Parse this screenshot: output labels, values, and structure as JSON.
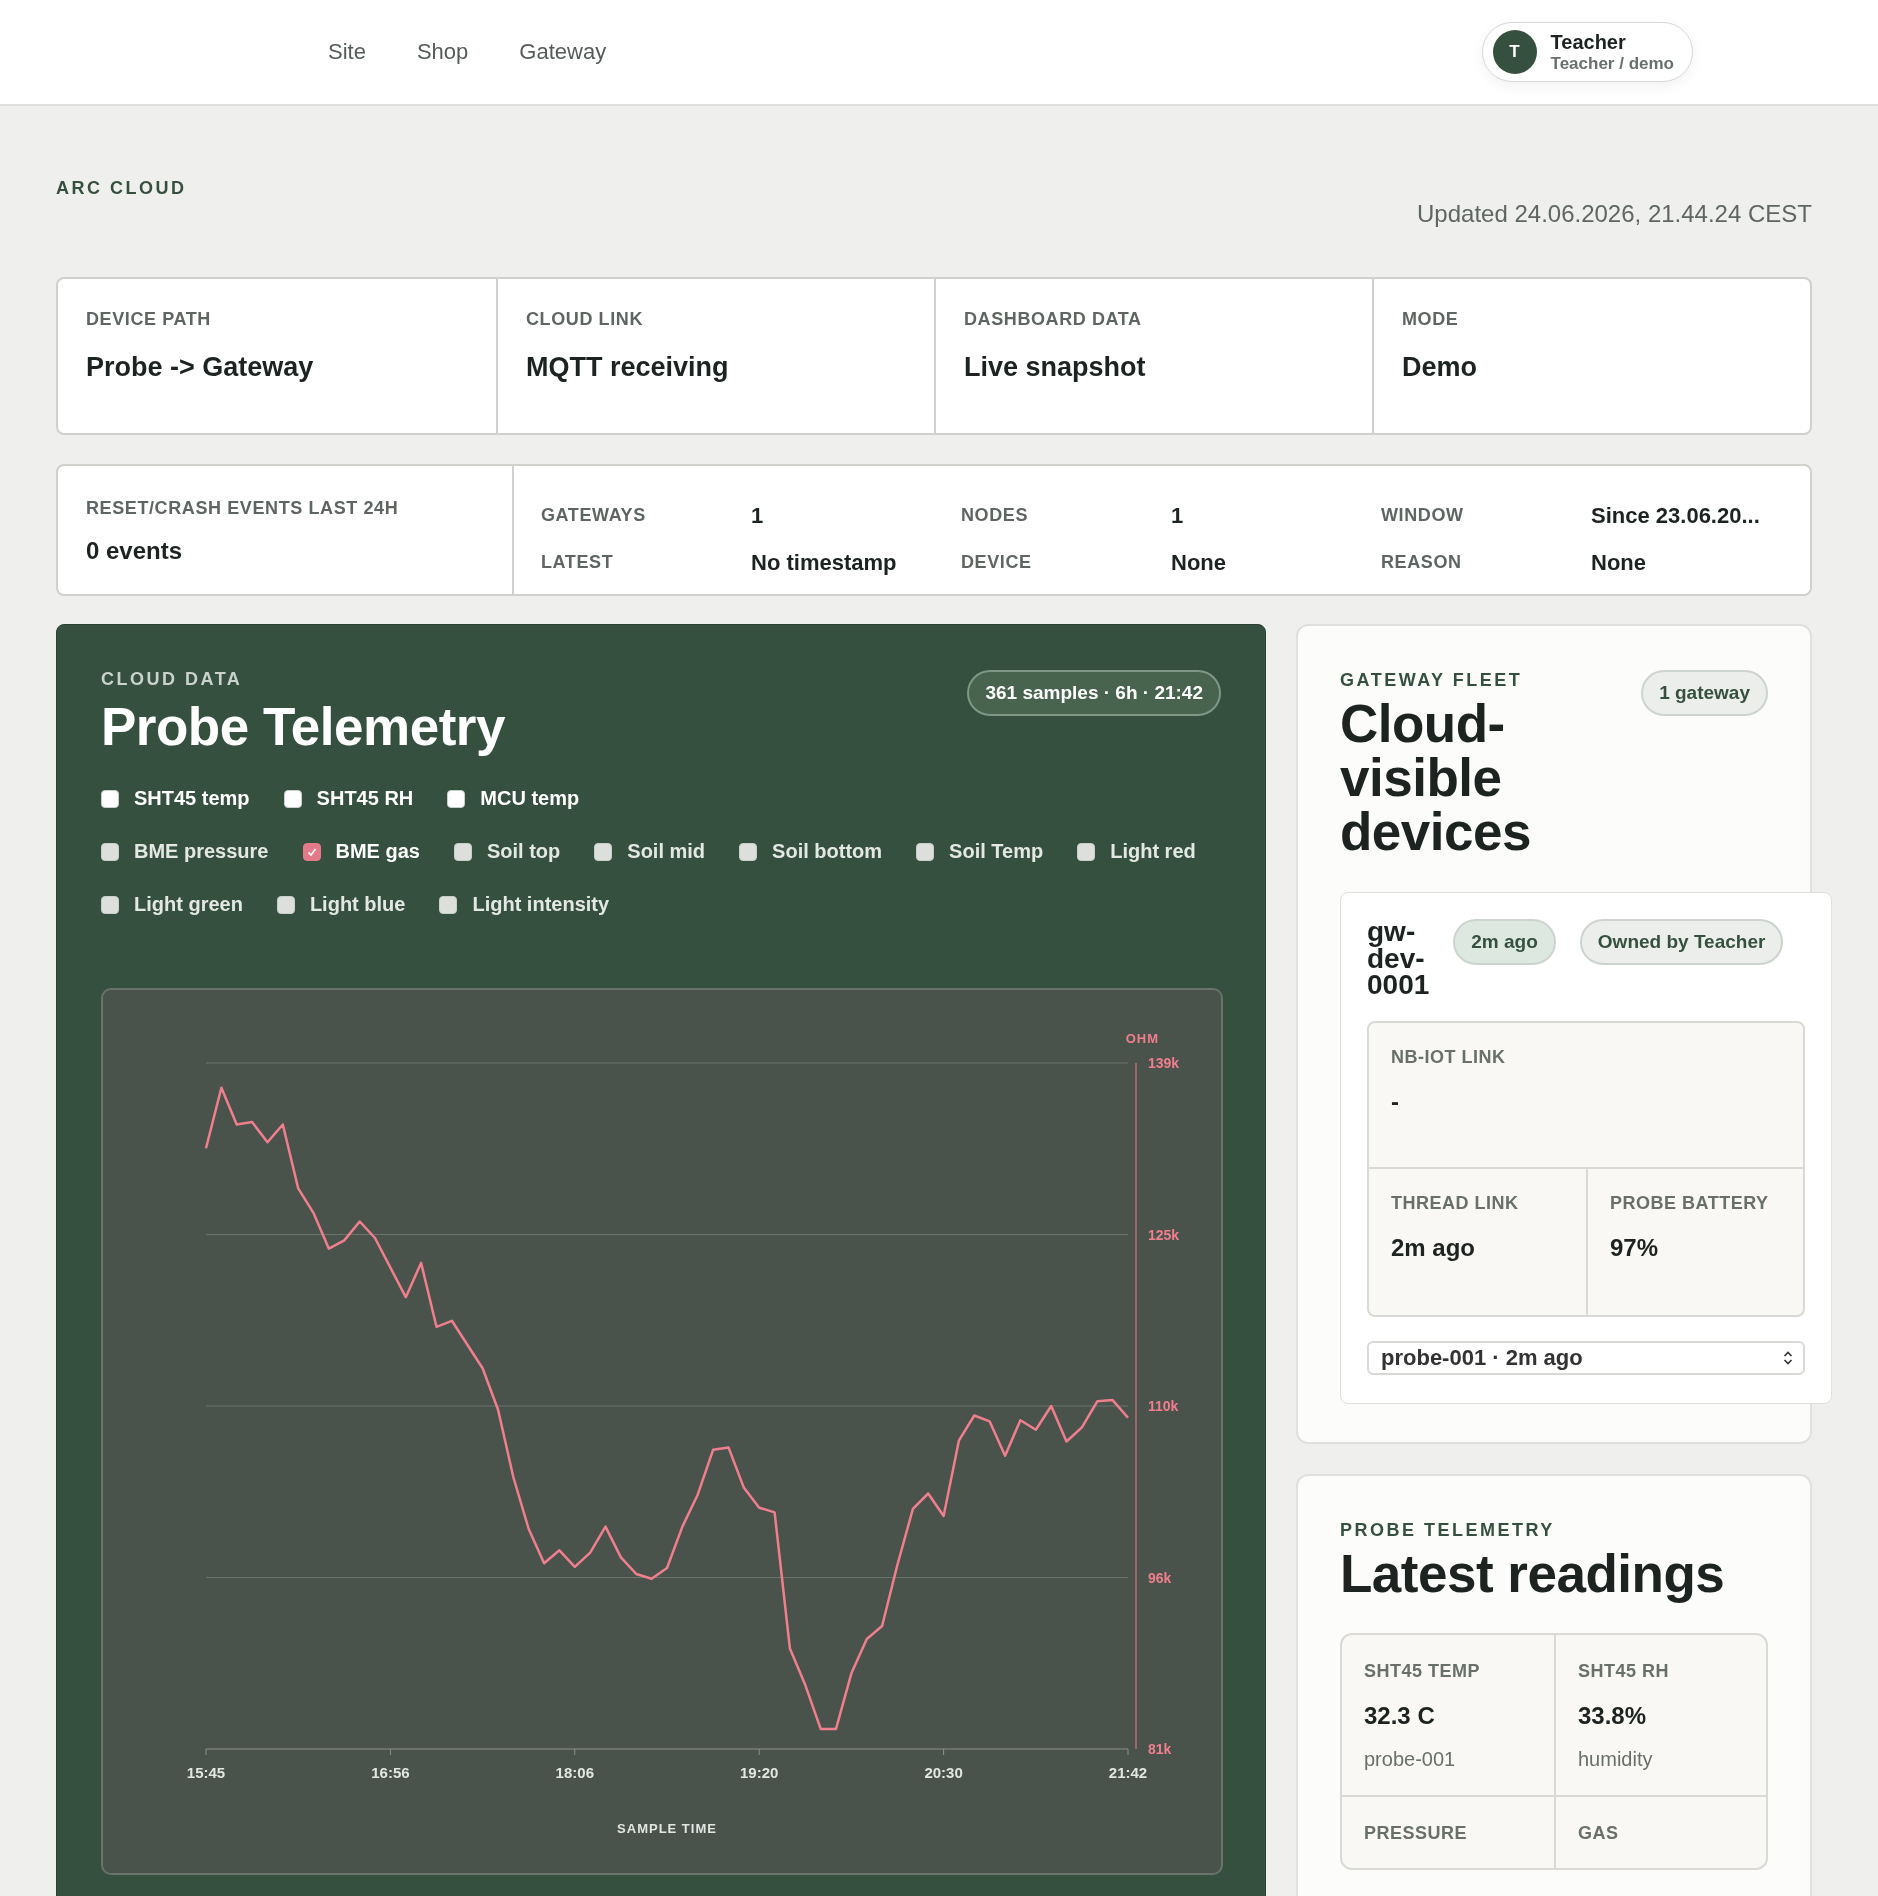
{
  "nav": {
    "links": [
      "Site",
      "Shop",
      "Gateway"
    ],
    "user": {
      "initial": "T",
      "name": "Teacher",
      "subtitle": "Teacher / demo"
    }
  },
  "header": {
    "eyebrow": "ARC CLOUD",
    "updated": "Updated 24.06.2026, 21.44.24 CEST"
  },
  "summary": [
    {
      "label": "DEVICE PATH",
      "value": "Probe -> Gateway"
    },
    {
      "label": "CLOUD LINK",
      "value": "MQTT receiving"
    },
    {
      "label": "DASHBOARD DATA",
      "value": "Live snapshot"
    },
    {
      "label": "MODE",
      "value": "Demo"
    }
  ],
  "events": {
    "label": "RESET/CRASH EVENTS LAST 24H",
    "value": "0 events",
    "stats": [
      {
        "label": "GATEWAYS",
        "value": "1"
      },
      {
        "label": "NODES",
        "value": "1"
      },
      {
        "label": "WINDOW",
        "value": "Since 23.06.20..."
      },
      {
        "label": "LATEST",
        "value": "No timestamp"
      },
      {
        "label": "DEVICE",
        "value": "None"
      },
      {
        "label": "REASON",
        "value": "None"
      }
    ]
  },
  "telemetry": {
    "eyebrow": "CLOUD DATA",
    "title": "Probe Telemetry",
    "badge": "361 samples · 6h · 21:42",
    "toggles": [
      {
        "label": "SHT45 temp",
        "checked": false,
        "disabled": false
      },
      {
        "label": "SHT45 RH",
        "checked": false,
        "disabled": false
      },
      {
        "label": "MCU temp",
        "checked": false,
        "disabled": false
      },
      {
        "label": "BME pressure",
        "checked": false,
        "disabled": true
      },
      {
        "label": "BME gas",
        "checked": true,
        "disabled": false
      },
      {
        "label": "Soil top",
        "checked": false,
        "disabled": true
      },
      {
        "label": "Soil mid",
        "checked": false,
        "disabled": true
      },
      {
        "label": "Soil bottom",
        "checked": false,
        "disabled": true
      },
      {
        "label": "Soil Temp",
        "checked": false,
        "disabled": true
      },
      {
        "label": "Light red",
        "checked": false,
        "disabled": true
      },
      {
        "label": "Light green",
        "checked": false,
        "disabled": true
      },
      {
        "label": "Light blue",
        "checked": false,
        "disabled": true
      },
      {
        "label": "Light intensity",
        "checked": false,
        "disabled": true
      }
    ],
    "chart_data": {
      "type": "line",
      "xlabel": "SAMPLE TIME",
      "ylabel": "OHM",
      "grid": true,
      "ylim": [
        81,
        139
      ],
      "categories": [
        "15:45",
        null,
        null,
        null,
        null,
        null,
        null,
        null,
        null,
        null,
        null,
        null,
        "16:56",
        null,
        null,
        null,
        null,
        null,
        null,
        null,
        null,
        null,
        null,
        null,
        "18:06",
        null,
        null,
        null,
        null,
        null,
        null,
        null,
        null,
        null,
        null,
        null,
        "19:20",
        null,
        null,
        null,
        null,
        null,
        null,
        null,
        null,
        null,
        null,
        null,
        "20:30",
        null,
        null,
        null,
        null,
        null,
        null,
        null,
        null,
        null,
        null,
        null,
        "21:42"
      ],
      "yticks": [
        {
          "value": 81,
          "label": "81k"
        },
        {
          "value": 95.5,
          "label": "96k"
        },
        {
          "value": 110,
          "label": "110k"
        },
        {
          "value": 124.5,
          "label": "125k"
        },
        {
          "value": 139,
          "label": "139k"
        }
      ],
      "series": [
        {
          "color": "#f07f8e",
          "values": [
            131.8,
            136.9,
            133.8,
            134.0,
            132.3,
            133.8,
            128.4,
            126.3,
            123.3,
            124.0,
            125.6,
            124.2,
            121.7,
            119.2,
            122.1,
            116.7,
            117.2,
            115.2,
            113.2,
            109.7,
            104.0,
            99.6,
            96.7,
            97.8,
            96.4,
            97.6,
            99.8,
            97.2,
            95.8,
            95.4,
            96.3,
            99.8,
            102.5,
            106.3,
            106.5,
            103.1,
            101.4,
            101.0,
            89.5,
            86.4,
            82.7,
            82.7,
            87.4,
            90.3,
            91.4,
            96.6,
            101.3,
            102.6,
            100.7,
            107.1,
            109.2,
            108.7,
            105.8,
            108.8,
            108.0,
            110.0,
            107.0,
            108.2,
            110.4,
            110.5,
            109.0
          ]
        }
      ]
    }
  },
  "fleet": {
    "eyebrow": "GATEWAY FLEET",
    "title": "Cloud-visible devices",
    "badge": "1 gateway",
    "device": {
      "name": "gw-dev-0001",
      "seen": "2m ago",
      "owner": "Owned by Teacher",
      "link": {
        "label": "NB-IOT LINK",
        "value": "-"
      },
      "metrics": [
        {
          "label": "THREAD LINK",
          "value": "2m ago"
        },
        {
          "label": "PROBE BATTERY",
          "value": "97%"
        }
      ],
      "probe_select": "probe-001 · 2m ago"
    }
  },
  "readings": {
    "eyebrow": "PROBE TELEMETRY",
    "title": "Latest readings",
    "cells": [
      {
        "label": "SHT45 TEMP",
        "value": "32.3 C",
        "note": "probe-001"
      },
      {
        "label": "SHT45 RH",
        "value": "33.8%",
        "note": "humidity"
      },
      {
        "label": "PRESSURE"
      },
      {
        "label": "GAS"
      }
    ]
  }
}
